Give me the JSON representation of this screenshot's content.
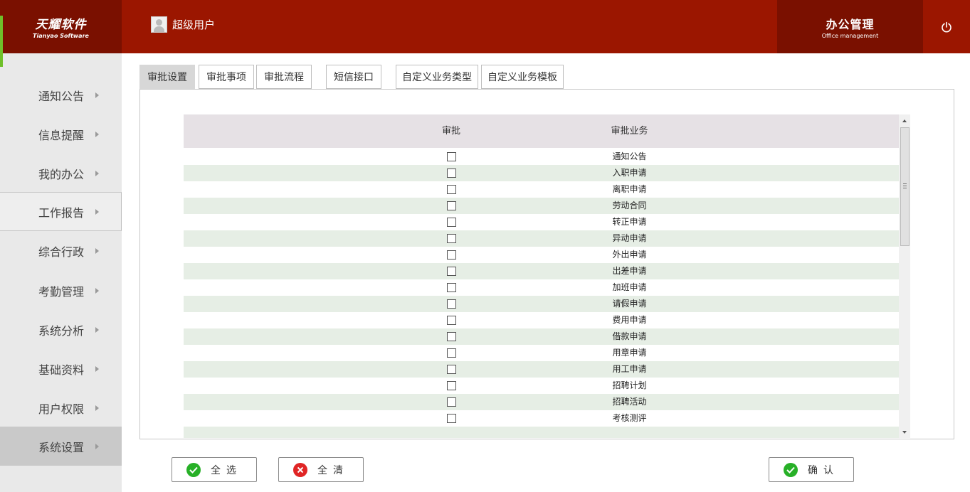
{
  "header": {
    "logo_main": "天耀软件",
    "logo_sub": "Tianyao Software",
    "user_name": "超级用户",
    "office_main": "办公管理",
    "office_sub": "Office management"
  },
  "sidebar": {
    "items": [
      {
        "label": "通知公告"
      },
      {
        "label": "信息提醒"
      },
      {
        "label": "我的办公"
      },
      {
        "label": "工作报告"
      },
      {
        "label": "综合行政"
      },
      {
        "label": "考勤管理"
      },
      {
        "label": "系统分析"
      },
      {
        "label": "基础资料"
      },
      {
        "label": "用户权限"
      },
      {
        "label": "系统设置"
      }
    ],
    "active": "系统设置"
  },
  "tabs": [
    {
      "label": "审批设置"
    },
    {
      "label": "审批事项"
    },
    {
      "label": "审批流程"
    },
    {
      "label": "短信接口"
    },
    {
      "label": "自定义业务类型"
    },
    {
      "label": "自定义业务模板"
    }
  ],
  "active_tab": "审批设置",
  "grid": {
    "columns": [
      "审批",
      "审批业务"
    ],
    "rows": [
      {
        "name": "通知公告",
        "checked": false
      },
      {
        "name": "入职申请",
        "checked": false
      },
      {
        "name": "离职申请",
        "checked": false
      },
      {
        "name": "劳动合同",
        "checked": false
      },
      {
        "name": "转正申请",
        "checked": false
      },
      {
        "name": "异动申请",
        "checked": false
      },
      {
        "name": "外出申请",
        "checked": false
      },
      {
        "name": "出差申请",
        "checked": false
      },
      {
        "name": "加班申请",
        "checked": false
      },
      {
        "name": "请假申请",
        "checked": false
      },
      {
        "name": "费用申请",
        "checked": false
      },
      {
        "name": "借款申请",
        "checked": false
      },
      {
        "name": "用章申请",
        "checked": false
      },
      {
        "name": "用工申请",
        "checked": false
      },
      {
        "name": "招聘计划",
        "checked": false
      },
      {
        "name": "招聘活动",
        "checked": false
      },
      {
        "name": "考核测评",
        "checked": false
      }
    ]
  },
  "buttons": {
    "select_all": "全选",
    "clear_all": "全清",
    "confirm": "确认"
  },
  "colors": {
    "header_bg": "#9b1600",
    "header_dark": "#7a1000",
    "accent_green": "#6fbf2a",
    "row_alt": "#e6eee5",
    "grid_head": "#e6e1e5"
  }
}
